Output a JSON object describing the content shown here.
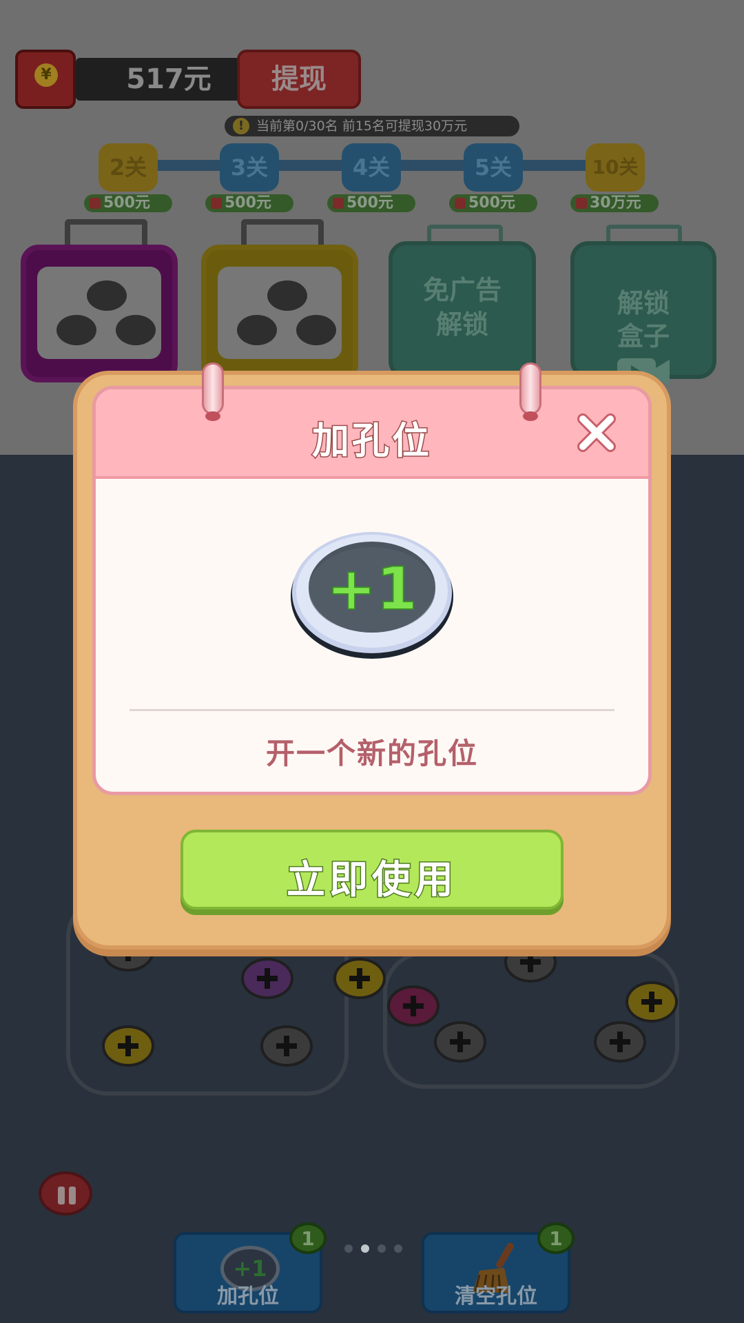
{
  "header": {
    "money_amount": "517元",
    "withdraw_label": "提现",
    "rank_text": "当前第0/30名  前15名可提现30万元"
  },
  "levels": [
    {
      "label": "2关",
      "reward": "500元"
    },
    {
      "label": "3关",
      "reward": "500元"
    },
    {
      "label": "4关",
      "reward": "500元"
    },
    {
      "label": "5关",
      "reward": "500元"
    },
    {
      "label": "10关",
      "reward": "30万元"
    }
  ],
  "boxes": {
    "no_ad_unlock": "免广告\n解锁",
    "unlock_box": "解锁\n盒子"
  },
  "modal": {
    "title": "加孔位",
    "icon_text": "+1",
    "description": "开一个新的孔位",
    "use_button": "立即使用"
  },
  "toolbar": {
    "tools": [
      {
        "label": "加孔位",
        "count": "1",
        "icon_text": "+1"
      },
      {
        "label": "清空孔位",
        "count": "1"
      }
    ],
    "page_count": 4,
    "active_page": 2
  },
  "colors": {
    "modal_frame": "#e8b97b",
    "modal_header": "#ffb6bc",
    "use_button": "#b3e85a",
    "plus_green": "#7ce34a"
  }
}
